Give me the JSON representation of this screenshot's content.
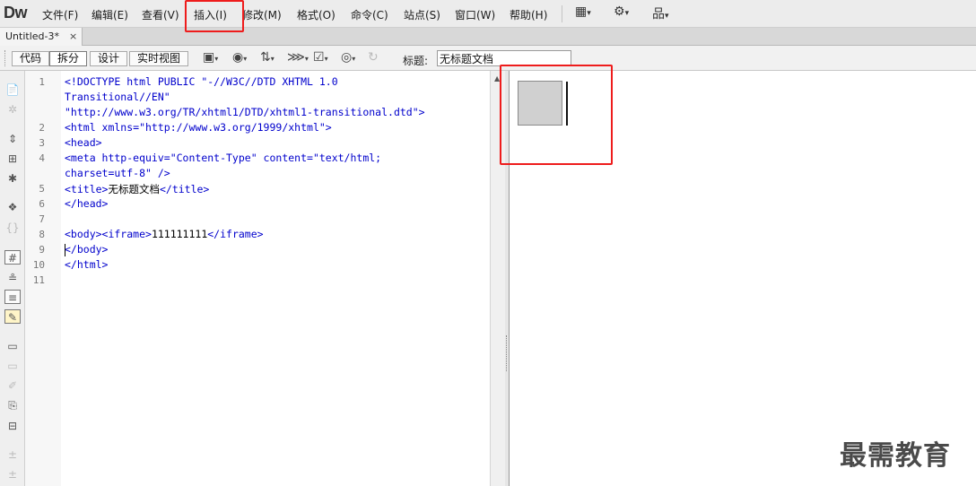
{
  "app": {
    "logo": "Dw",
    "menu": [
      "文件(F)",
      "编辑(E)",
      "查看(V)",
      "插入(I)",
      "修改(M)",
      "格式(O)",
      "命令(C)",
      "站点(S)",
      "窗口(W)",
      "帮助(H)"
    ],
    "menu_icons": [
      "layout-icon",
      "gear-icon",
      "site-structure-icon"
    ],
    "highlighted_menu": "插入(I)"
  },
  "tab": {
    "label": "Untitled-3*",
    "close": "×"
  },
  "toolbar": {
    "views": [
      "代码",
      "拆分",
      "设计",
      "实时视图"
    ],
    "active_view": "拆分",
    "icons": [
      "multiscreen-icon",
      "preview-browser-icon",
      "file-management-icon",
      "check-browser-icon",
      "validate-icon",
      "visual-aids-icon",
      "refresh-icon"
    ],
    "title_label": "标题:",
    "title_value": "无标题文档"
  },
  "left_toolbar": {
    "icons": [
      "open-documents-icon",
      "collapse-tag-icon",
      "collapse-selection-icon",
      "expand-all-icon",
      "select-parent-tag-icon",
      "balance-braces-icon",
      "line-numbers-icon",
      "highlight-invalid-icon",
      "syntax-coloring-icon",
      "word-wrap-icon",
      "apply-comment-icon",
      "remove-comment-icon",
      "wrap-tag-icon",
      "recent-snippets-icon",
      "move-css-icon",
      "indent-icon",
      "outdent-icon"
    ]
  },
  "code": {
    "line_numbers": [
      "1",
      "2",
      "3",
      "4",
      "5",
      "6",
      "7",
      "8",
      "9",
      "10",
      "11"
    ],
    "lines": [
      "<!DOCTYPE html PUBLIC \"-//W3C//DTD XHTML 1.0",
      "Transitional//EN\"",
      "\"http://www.w3.org/TR/xhtml1/DTD/xhtml1-transitional.dtd\">",
      "<html xmlns=\"http://www.w3.org/1999/xhtml\">",
      "<head>",
      "<meta http-equiv=\"Content-Type\" content=\"text/html;",
      "charset=utf-8\" />",
      "</head>",
      "",
      "",
      "</body>",
      "</html>"
    ],
    "title_open": "<title>",
    "title_text": "无标题文档",
    "title_close": "</title>",
    "body_open": "<body><iframe>",
    "body_text": "111111111",
    "body_close": "</iframe>"
  },
  "watermark": "最需教育"
}
